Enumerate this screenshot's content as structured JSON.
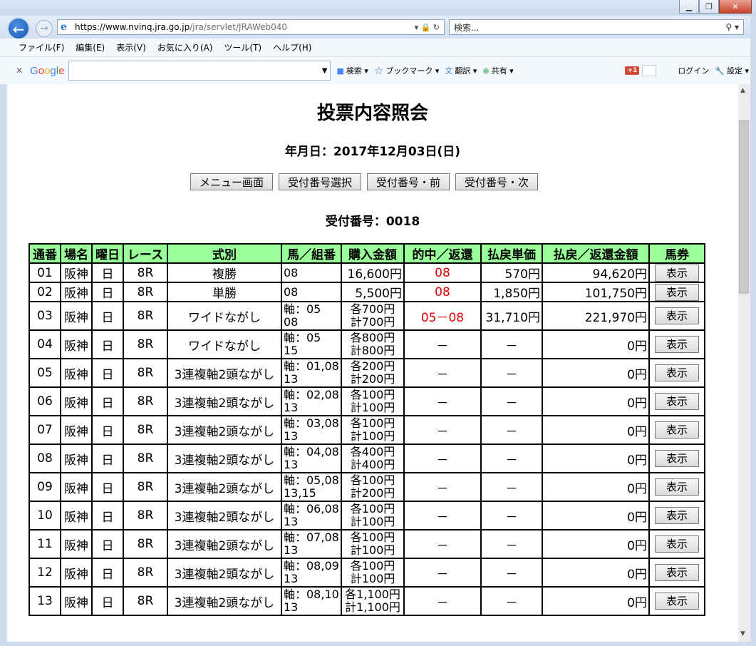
{
  "browser": {
    "url_host": "https://www.nvinq.jra.go.jp",
    "url_rest": "/jra/servlet/JRAWeb040",
    "search_placeholder": "検索...",
    "menu": [
      "ファイル(F)",
      "編集(E)",
      "表示(V)",
      "お気に入り(A)",
      "ツール(T)",
      "ヘルプ(H)"
    ],
    "google_toolbar": {
      "logo": "Google",
      "search_label": "検索",
      "bookmark_label": "ブックマーク",
      "translate_label": "翻訳",
      "share_label": "共有",
      "login_label": "ログイン",
      "settings_label": "設定",
      "gplus_label": "+1"
    }
  },
  "page": {
    "title": "投票内容照会",
    "date_line": "年月日：2017年12月03日(日)",
    "buttons": [
      "メニュー画面",
      "受付番号選択",
      "受付番号・前",
      "受付番号・次"
    ],
    "receipt_line": "受付番号：0018"
  },
  "table": {
    "headers": [
      "通番",
      "場名",
      "曜日",
      "レース",
      "式別",
      "馬／組番",
      "購入金額",
      "的中／返還",
      "払戻単価",
      "払戻／返還金額",
      "馬券"
    ],
    "show_label": "表示",
    "rows": [
      {
        "no": "01",
        "place": "阪神",
        "day": "日",
        "race": "8R",
        "type": "複勝",
        "kumi1": "08",
        "kumi2": "",
        "amt1": "16,600円",
        "amt2": "",
        "hit": "08",
        "unit": "570円",
        "payout": "94,620円"
      },
      {
        "no": "02",
        "place": "阪神",
        "day": "日",
        "race": "8R",
        "type": "単勝",
        "kumi1": "08",
        "kumi2": "",
        "amt1": "5,500円",
        "amt2": "",
        "hit": "08",
        "unit": "1,850円",
        "payout": "101,750円"
      },
      {
        "no": "03",
        "place": "阪神",
        "day": "日",
        "race": "8R",
        "type": "ワイドながし",
        "kumi1": "軸：05",
        "kumi2": "08",
        "amt1": "各700円",
        "amt2": "計700円",
        "hit": "05－08",
        "unit": "31,710円",
        "payout": "221,970円"
      },
      {
        "no": "04",
        "place": "阪神",
        "day": "日",
        "race": "8R",
        "type": "ワイドながし",
        "kumi1": "軸：05",
        "kumi2": "15",
        "amt1": "各800円",
        "amt2": "計800円",
        "hit": "－",
        "unit": "－",
        "payout": "0円"
      },
      {
        "no": "05",
        "place": "阪神",
        "day": "日",
        "race": "8R",
        "type": "3連複軸2頭ながし",
        "kumi1": "軸：01,08",
        "kumi2": "13",
        "amt1": "各200円",
        "amt2": "計200円",
        "hit": "－",
        "unit": "－",
        "payout": "0円"
      },
      {
        "no": "06",
        "place": "阪神",
        "day": "日",
        "race": "8R",
        "type": "3連複軸2頭ながし",
        "kumi1": "軸：02,08",
        "kumi2": "13",
        "amt1": "各100円",
        "amt2": "計100円",
        "hit": "－",
        "unit": "－",
        "payout": "0円"
      },
      {
        "no": "07",
        "place": "阪神",
        "day": "日",
        "race": "8R",
        "type": "3連複軸2頭ながし",
        "kumi1": "軸：03,08",
        "kumi2": "13",
        "amt1": "各100円",
        "amt2": "計100円",
        "hit": "－",
        "unit": "－",
        "payout": "0円"
      },
      {
        "no": "08",
        "place": "阪神",
        "day": "日",
        "race": "8R",
        "type": "3連複軸2頭ながし",
        "kumi1": "軸：04,08",
        "kumi2": "13",
        "amt1": "各400円",
        "amt2": "計400円",
        "hit": "－",
        "unit": "－",
        "payout": "0円"
      },
      {
        "no": "09",
        "place": "阪神",
        "day": "日",
        "race": "8R",
        "type": "3連複軸2頭ながし",
        "kumi1": "軸：05,08",
        "kumi2": "13,15",
        "amt1": "各100円",
        "amt2": "計200円",
        "hit": "－",
        "unit": "－",
        "payout": "0円"
      },
      {
        "no": "10",
        "place": "阪神",
        "day": "日",
        "race": "8R",
        "type": "3連複軸2頭ながし",
        "kumi1": "軸：06,08",
        "kumi2": "13",
        "amt1": "各100円",
        "amt2": "計100円",
        "hit": "－",
        "unit": "－",
        "payout": "0円"
      },
      {
        "no": "11",
        "place": "阪神",
        "day": "日",
        "race": "8R",
        "type": "3連複軸2頭ながし",
        "kumi1": "軸：07,08",
        "kumi2": "13",
        "amt1": "各100円",
        "amt2": "計100円",
        "hit": "－",
        "unit": "－",
        "payout": "0円"
      },
      {
        "no": "12",
        "place": "阪神",
        "day": "日",
        "race": "8R",
        "type": "3連複軸2頭ながし",
        "kumi1": "軸：08,09",
        "kumi2": "13",
        "amt1": "各100円",
        "amt2": "計100円",
        "hit": "－",
        "unit": "－",
        "payout": "0円"
      },
      {
        "no": "13",
        "place": "阪神",
        "day": "日",
        "race": "8R",
        "type": "3連複軸2頭ながし",
        "kumi1": "軸：08,10",
        "kumi2": "13",
        "amt1": "各1,100円",
        "amt2": "計1,100円",
        "hit": "－",
        "unit": "－",
        "payout": "0円"
      }
    ]
  }
}
